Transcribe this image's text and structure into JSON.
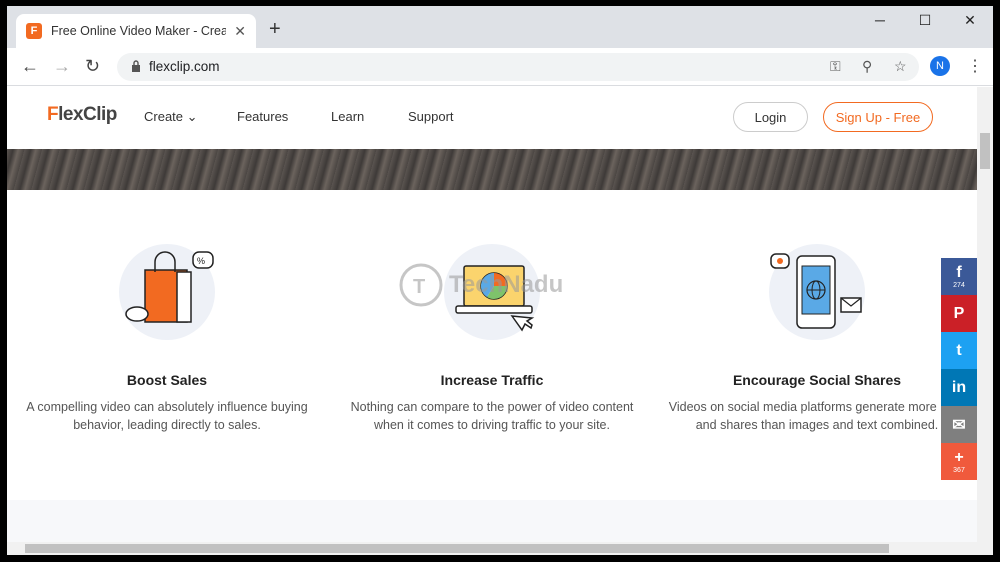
{
  "browser": {
    "tab_title": "Free Online Video Maker - Create",
    "tab_favicon": "F",
    "tab_close": "✕",
    "new_tab": "+",
    "url": "flexclip.com",
    "profile_initial": "N",
    "window_controls": {
      "minimize": "─",
      "maximize": "☐",
      "close": "✕"
    }
  },
  "site": {
    "logo_f": "F",
    "logo_rest": "lexClip",
    "nav": [
      {
        "label": "Create ⌄"
      },
      {
        "label": "Features"
      },
      {
        "label": "Learn"
      },
      {
        "label": "Support"
      }
    ],
    "login_label": "Login",
    "signup_label": "Sign Up - Free"
  },
  "features": [
    {
      "title": "Boost Sales",
      "desc": "A compelling video can absolutely influence buying behavior, leading directly to sales."
    },
    {
      "title": "Increase Traffic",
      "desc": "Nothing can compare to the power of video content when it comes to driving traffic to your site."
    },
    {
      "title": "Encourage Social Shares",
      "desc": "Videos on social media platforms generate more likes and shares than images and text combined."
    }
  ],
  "watermark": "TechNadu",
  "share": [
    {
      "name": "facebook",
      "glyph": "f",
      "count": "274",
      "color": "#3b5998"
    },
    {
      "name": "pinterest",
      "glyph": "P",
      "count": "",
      "color": "#cb2027"
    },
    {
      "name": "twitter",
      "glyph": "t",
      "count": "",
      "color": "#1da1f2"
    },
    {
      "name": "linkedin",
      "glyph": "in",
      "count": "",
      "color": "#0077b5"
    },
    {
      "name": "email",
      "glyph": "✉",
      "count": "",
      "color": "#7f7f7f"
    },
    {
      "name": "more",
      "glyph": "+",
      "count": "367",
      "color": "#f05a3c"
    }
  ],
  "colors": {
    "brand": "#f26a21"
  }
}
